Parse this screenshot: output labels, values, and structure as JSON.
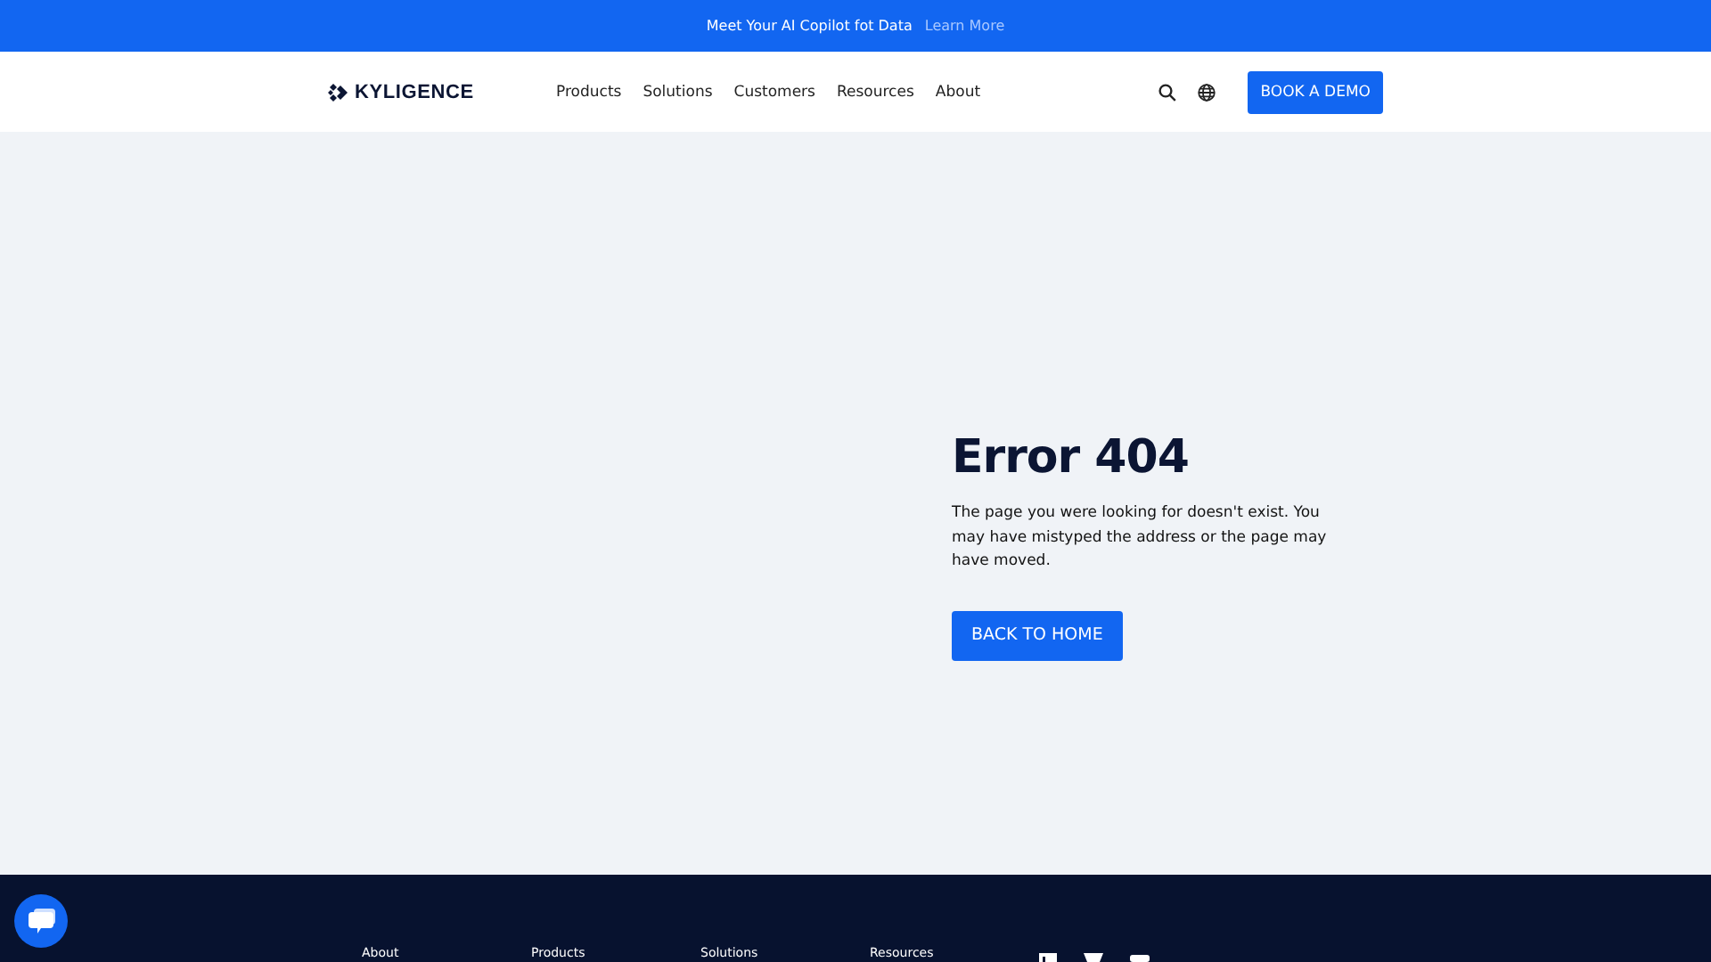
{
  "banner": {
    "text": "Meet Your AI Copilot fot Data",
    "link": "Learn More"
  },
  "nav": {
    "logo": "KYLIGENCE",
    "items": [
      "Products",
      "Solutions",
      "Customers",
      "Resources",
      "About"
    ],
    "cta": "BOOK A DEMO"
  },
  "error": {
    "title": "Error 404",
    "message": "The page you were looking for doesn't exist. You may have mistyped the address or the page may have moved.",
    "button": "BACK TO HOME"
  },
  "footer": {
    "headings": [
      "About",
      "Products",
      "Solutions",
      "Resources"
    ]
  }
}
